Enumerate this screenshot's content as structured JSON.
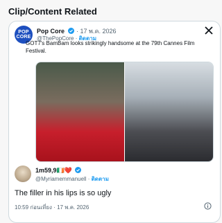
{
  "section_title": "Clip/Content Related",
  "embedded_tweet": {
    "avatar_text": [
      "POP",
      "CORE"
    ],
    "name": "Pop Core",
    "date": "· 17 พ.ค. 2026",
    "handle": "@ThePopCore",
    "follow_label": "ติดตาม",
    "text": "GOT7's BamBam looks strikingly handsome at the 79th Cannes Film Festival.",
    "media_count": 2
  },
  "reply": {
    "name": "1m59,9🇮🇪❤️",
    "handle": "@Myriamemmanuell",
    "follow_label": "ติดตาม",
    "text": "The filler in his lips is so ugly",
    "time": "10:59 ก่อนเที่ยง · 17 พ.ค. 2026"
  },
  "colors": {
    "accent": "#1d9bf0",
    "muted": "#536471",
    "border": "#cfd9de"
  },
  "icons": [
    "verified-badge-icon",
    "x-logo-icon",
    "info-icon"
  ]
}
